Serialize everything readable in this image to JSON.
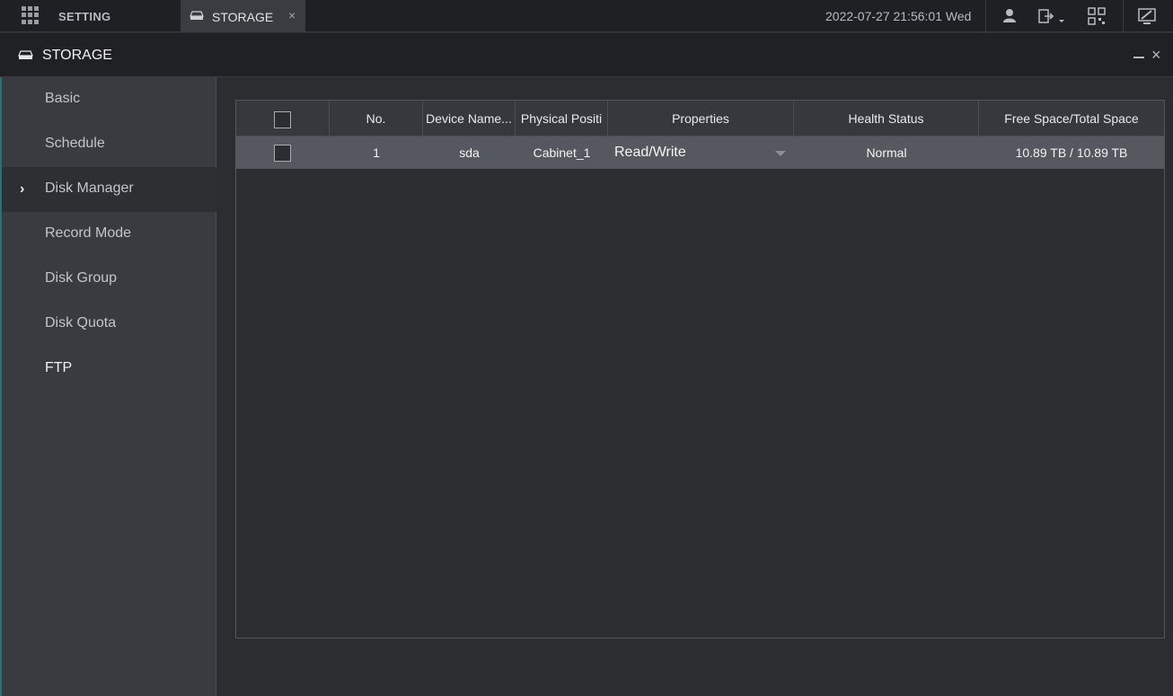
{
  "topbar": {
    "setting_label": "SETTING",
    "tab_label": "STORAGE",
    "tab_close": "×",
    "datetime": "2022-07-27 21:56:01 Wed"
  },
  "window": {
    "title": "STORAGE",
    "close": "×"
  },
  "sidebar": {
    "items": [
      {
        "label": "Basic"
      },
      {
        "label": "Schedule"
      },
      {
        "label": "Disk Manager",
        "active": true
      },
      {
        "label": "Record Mode"
      },
      {
        "label": "Disk Group"
      },
      {
        "label": "Disk Quota"
      },
      {
        "label": "FTP"
      }
    ],
    "chevron": "›"
  },
  "table": {
    "columns": [
      "No.",
      "Device Name...",
      "Physical Positi",
      "Properties",
      "Health Status",
      "Free Space/Total Space"
    ],
    "rows": [
      {
        "no": "1",
        "device": "sda",
        "position": "Cabinet_1",
        "properties": "Read/Write",
        "health": "Normal",
        "space": "10.89 TB / 10.89 TB"
      }
    ]
  },
  "colors": {
    "accent_edge": "#2c6f74",
    "row_selected": "#55585e",
    "header_bg": "#36383d"
  }
}
